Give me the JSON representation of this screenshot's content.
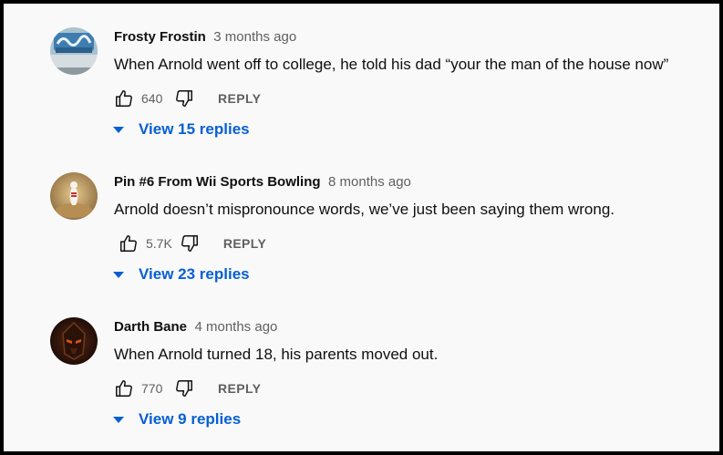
{
  "comments": [
    {
      "author": "Frosty Frostin",
      "time": "3 months ago",
      "text": "When Arnold went off to college, he told his dad “your the man of the house now”",
      "likes": "640",
      "reply_label": "REPLY",
      "view_replies": "View 15 replies",
      "avatar_icon": "snow-scene-avatar"
    },
    {
      "author": "Pin #6 From Wii Sports Bowling",
      "time": "8 months ago",
      "text": "Arnold doesn’t mispronounce words, we’ve just been saying them wrong.",
      "likes": "5.7K",
      "reply_label": "REPLY",
      "view_replies": "View 23 replies",
      "avatar_icon": "bowling-pin-avatar"
    },
    {
      "author": "Darth Bane",
      "time": "4 months ago",
      "text": "When Arnold turned 18, his parents moved out.",
      "likes": "770",
      "reply_label": "REPLY",
      "view_replies": "View 9 replies",
      "avatar_icon": "sith-helmet-avatar"
    }
  ],
  "colors": {
    "link_blue": "#065fd4",
    "muted_text": "#606060",
    "background": "#f9f9f9"
  }
}
